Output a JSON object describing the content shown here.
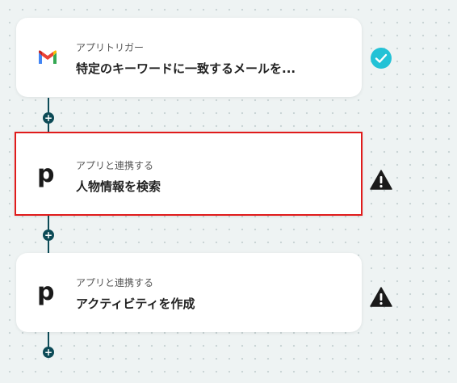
{
  "steps": [
    {
      "label": "アプリトリガー",
      "title": "特定のキーワードに一致するメールを...",
      "app_icon": "gmail-icon",
      "status": "check-icon",
      "status_color": "#23c2d6"
    },
    {
      "label": "アプリと連携する",
      "title": "人物情報を検索",
      "app_icon": "p-logo-icon",
      "status": "warning-icon",
      "status_color": "#1a1a1a"
    },
    {
      "label": "アプリと連携する",
      "title": "アクティビティを作成",
      "app_icon": "p-logo-icon",
      "status": "warning-icon",
      "status_color": "#1a1a1a"
    }
  ],
  "p_logo_text": "p",
  "add_symbol": "+",
  "colors": {
    "connector": "#0d4b57",
    "selected_border": "#e01b1b"
  }
}
